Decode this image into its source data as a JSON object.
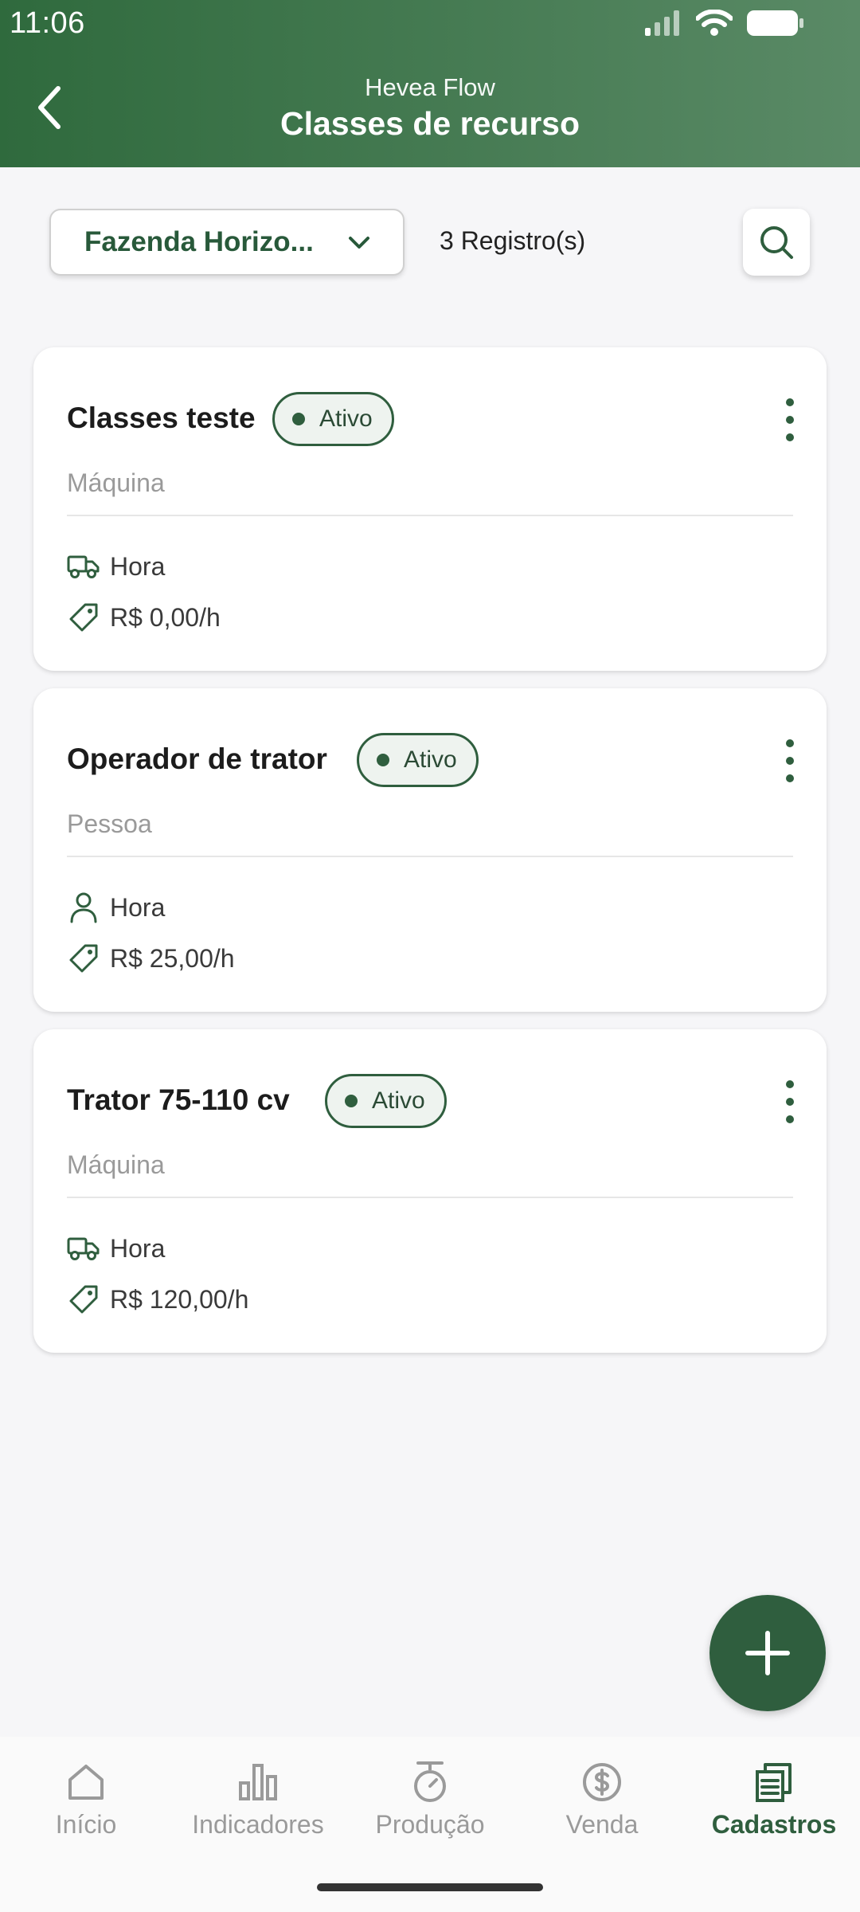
{
  "status_bar": {
    "time": "11:06"
  },
  "header": {
    "app_name": "Hevea Flow",
    "title": "Classes de recurso"
  },
  "toolbar": {
    "farm_selected": "Fazenda Horizo...",
    "record_count": "3 Registro(s)"
  },
  "cards": [
    {
      "title": "Classes teste",
      "status": "Ativo",
      "type": "Máquina",
      "unit_icon": "truck-icon",
      "unit": "Hora",
      "price": "R$ 0,00/h"
    },
    {
      "title": "Operador de trator",
      "status": "Ativo",
      "type": "Pessoa",
      "unit_icon": "person-icon",
      "unit": "Hora",
      "price": "R$ 25,00/h"
    },
    {
      "title": "Trator 75-110 cv",
      "status": "Ativo",
      "type": "Máquina",
      "unit_icon": "truck-icon",
      "unit": "Hora",
      "price": "R$ 120,00/h"
    }
  ],
  "bottom_nav": [
    {
      "label": "Início",
      "icon": "home-icon"
    },
    {
      "label": "Indicadores",
      "icon": "bar-chart-icon"
    },
    {
      "label": "Produção",
      "icon": "scale-icon"
    },
    {
      "label": "Venda",
      "icon": "dollar-icon"
    },
    {
      "label": "Cadastros",
      "icon": "register-icon",
      "active": true
    }
  ],
  "colors": {
    "primary": "#2f5e3e",
    "header_start": "#2f6a3d",
    "header_end": "#5a8a66"
  }
}
